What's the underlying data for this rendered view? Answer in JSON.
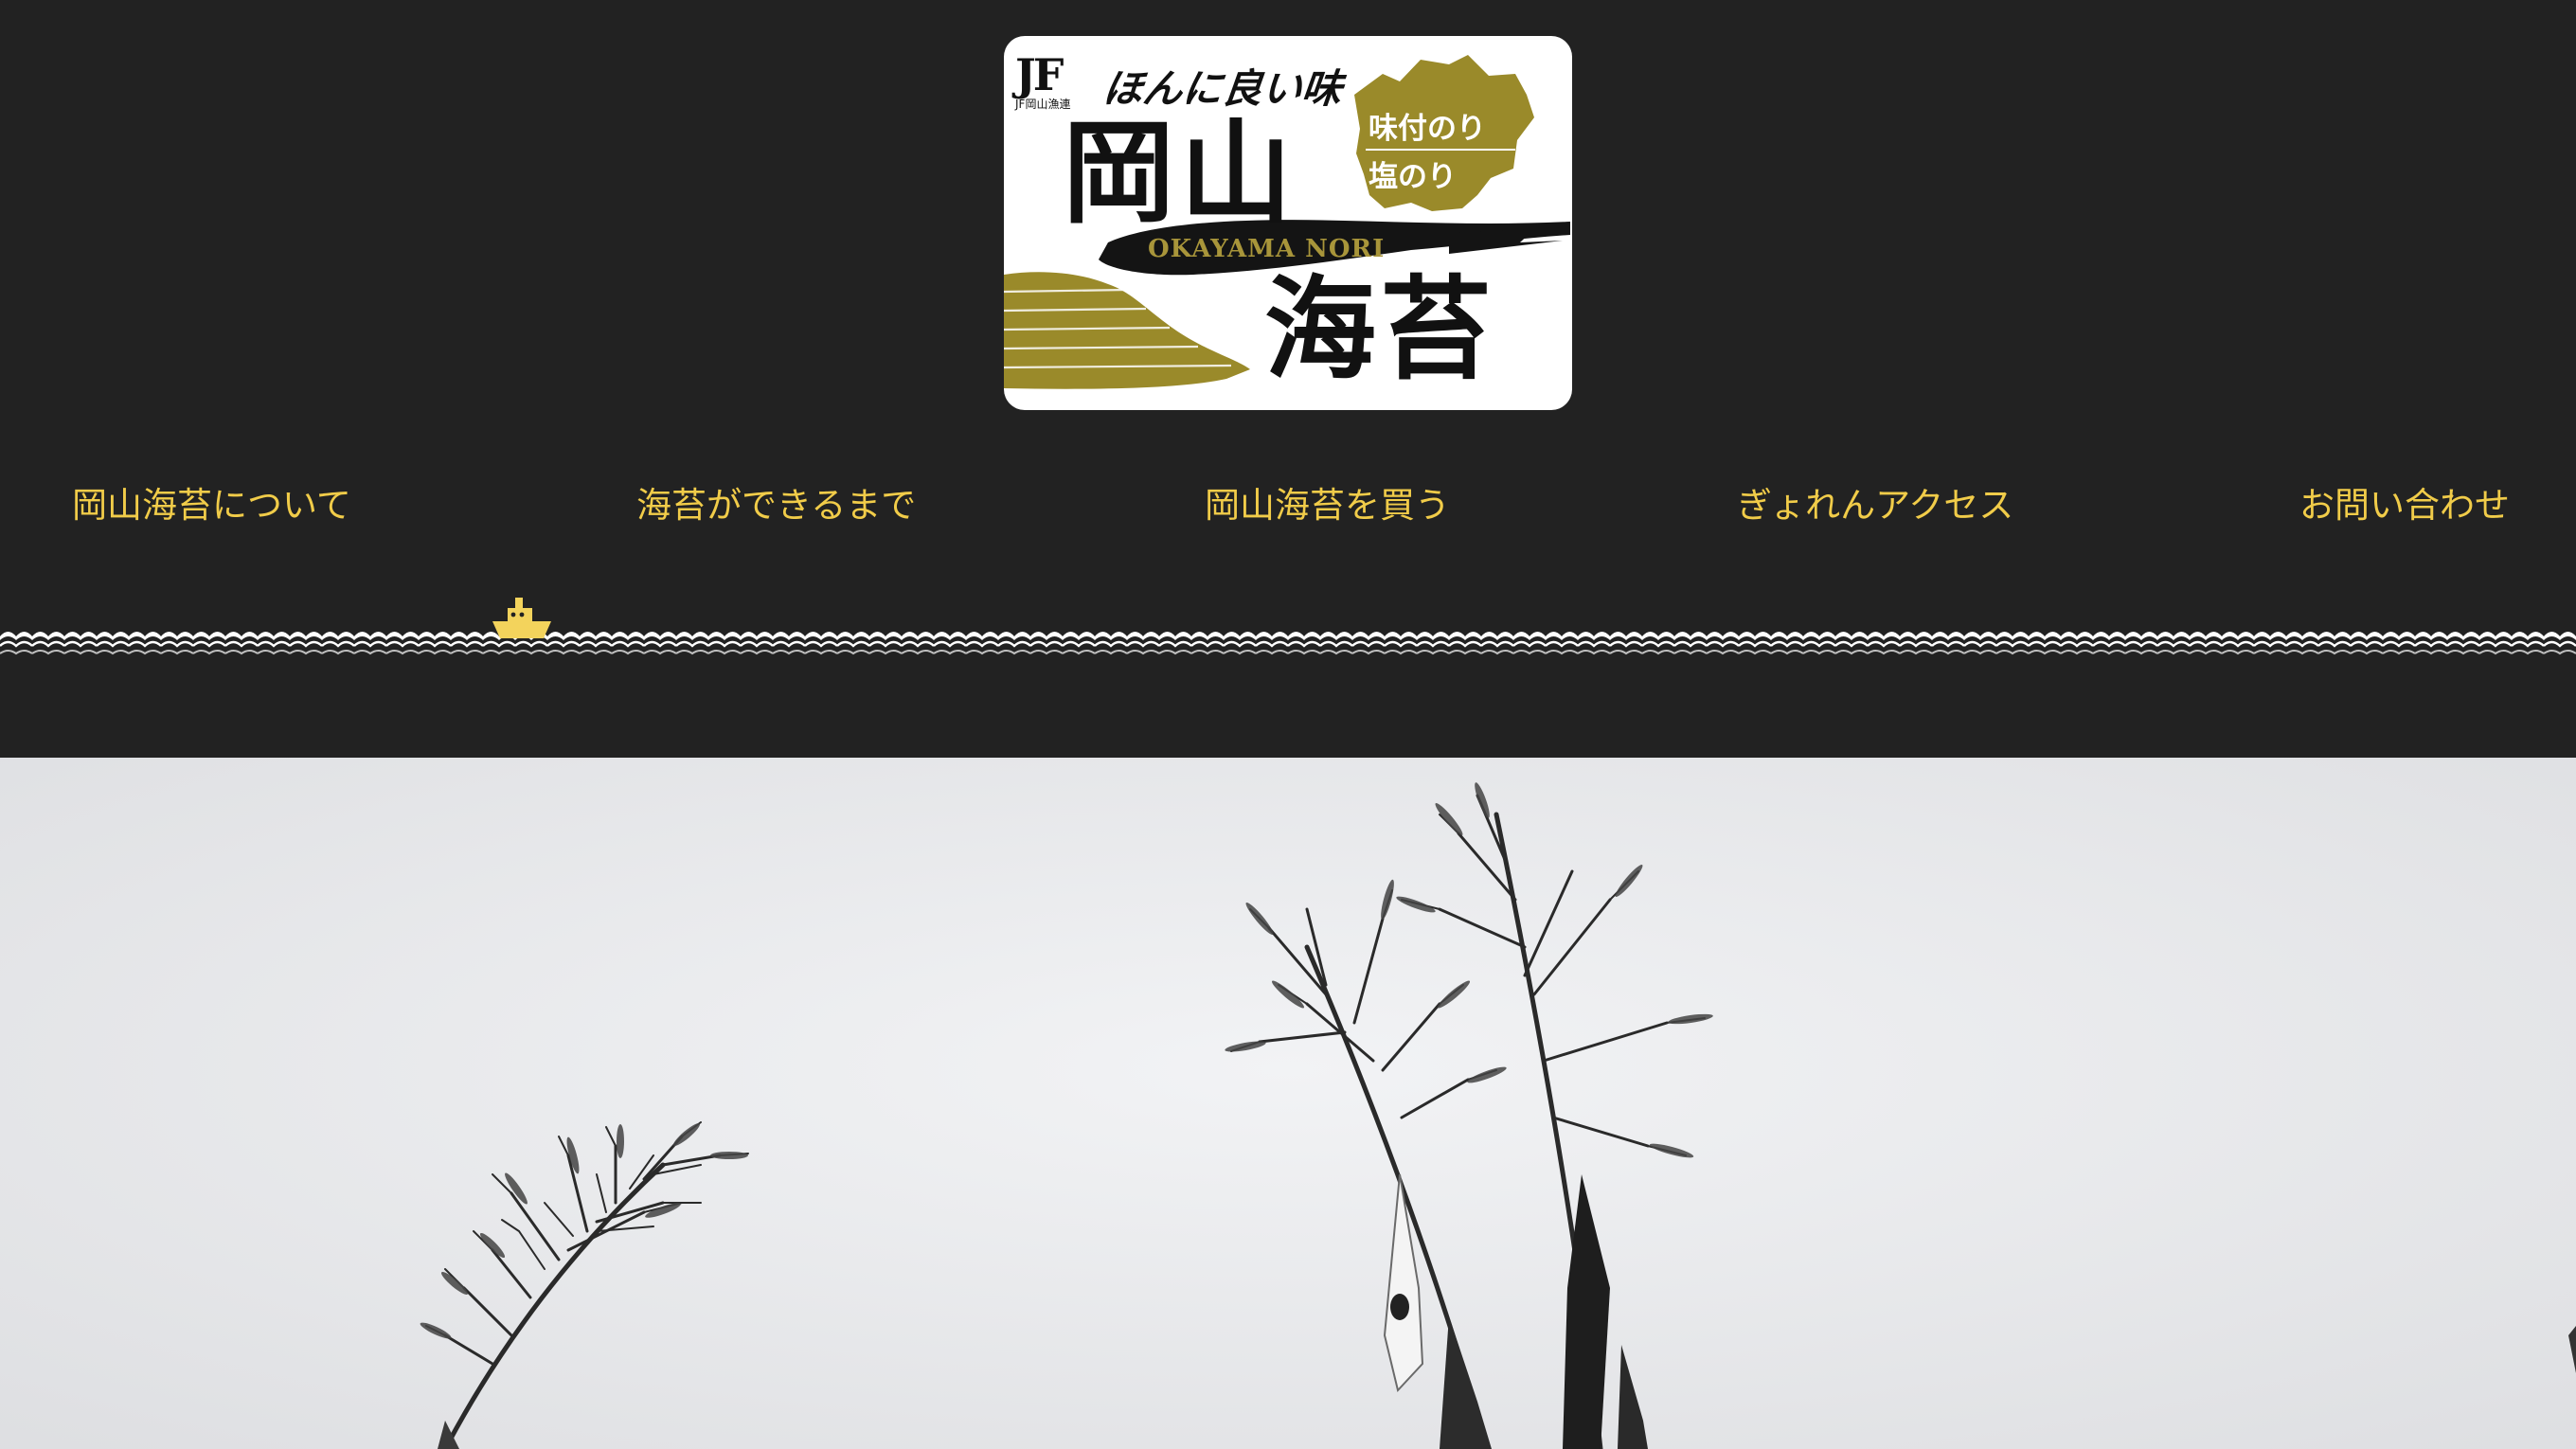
{
  "logo": {
    "jf_mark": "JF",
    "jf_org": "JF岡山漁連",
    "tagline": "ほんに良い味",
    "title_top": "岡山",
    "title_bottom": "海苔",
    "title_en": "OKAYAMA NORI",
    "badge_line1": "味付のり",
    "badge_line2": "塩のり",
    "accent_color": "#9a8a2a"
  },
  "nav": {
    "items": [
      {
        "label": "岡山海苔について"
      },
      {
        "label": "海苔ができるまで"
      },
      {
        "label": "岡山海苔を買う"
      },
      {
        "label": "ぎょれんアクセス"
      },
      {
        "label": "お問い合わせ"
      }
    ],
    "text_color": "#f1cc49"
  },
  "decor": {
    "ship_icon": "ship-icon",
    "wave_icon": "wave-divider",
    "ship_color": "#f3d35c"
  },
  "hero": {
    "image": "bamboo-streamers-photo",
    "background": "#eceef0"
  }
}
